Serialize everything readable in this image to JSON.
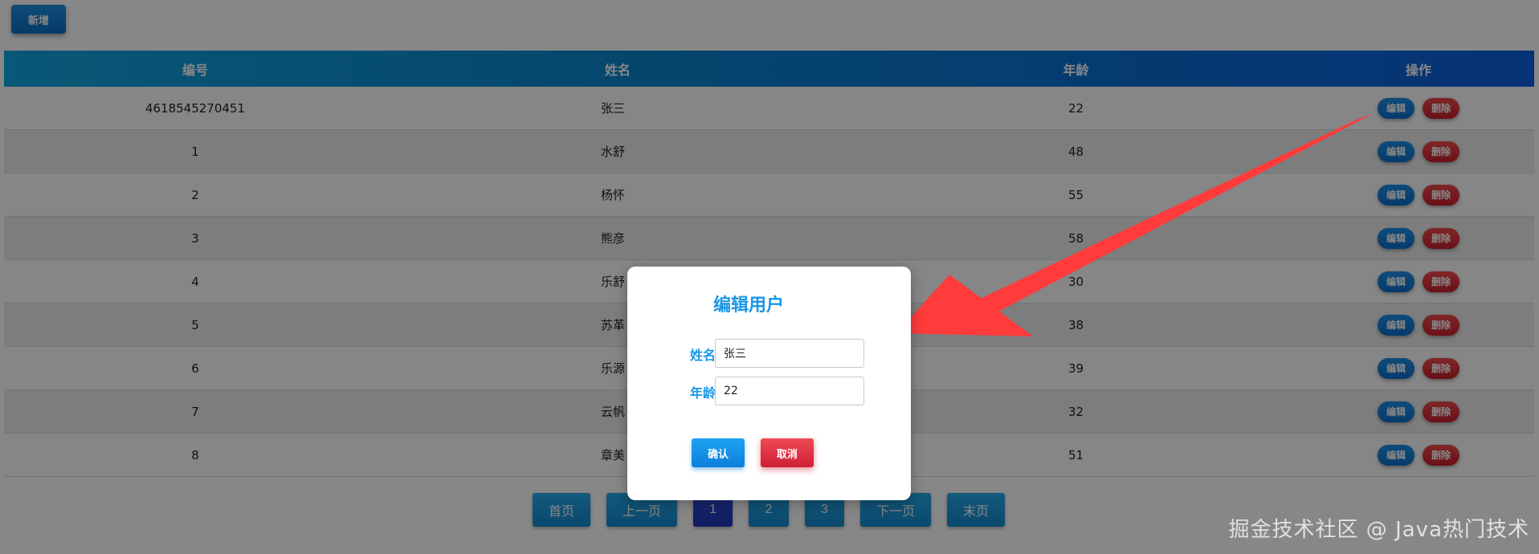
{
  "toolbar": {
    "add_label": "新增"
  },
  "table": {
    "headers": [
      "编号",
      "姓名",
      "年龄",
      "操作"
    ],
    "rows": [
      {
        "id": "4618545270451",
        "name": "张三",
        "age": "22"
      },
      {
        "id": "1",
        "name": "水舒",
        "age": "48"
      },
      {
        "id": "2",
        "name": "杨怀",
        "age": "55"
      },
      {
        "id": "3",
        "name": "熊彦",
        "age": "58"
      },
      {
        "id": "4",
        "name": "乐舒",
        "age": "30"
      },
      {
        "id": "5",
        "name": "苏革",
        "age": "38"
      },
      {
        "id": "6",
        "name": "乐源",
        "age": "39"
      },
      {
        "id": "7",
        "name": "云帆",
        "age": "32"
      },
      {
        "id": "8",
        "name": "章美",
        "age": "51"
      }
    ],
    "edit_label": "编辑",
    "delete_label": "删除"
  },
  "pager": {
    "first": "首页",
    "prev": "上一页",
    "pages": [
      "1",
      "2",
      "3"
    ],
    "active_page": "1",
    "next": "下一页",
    "last": "末页"
  },
  "modal": {
    "title": "编辑用户",
    "name_label": "姓名",
    "name_value": "张三",
    "age_label": "年龄",
    "age_value": "22",
    "confirm_label": "确认",
    "cancel_label": "取消"
  },
  "watermark": "掘金技术社区 @ Java热门技术",
  "colors": {
    "accent": "#1a96e8",
    "header_start": "#12a6e0",
    "header_end": "#0d5fe0",
    "danger": "#d01f36",
    "arrow": "#ff3b3b"
  }
}
